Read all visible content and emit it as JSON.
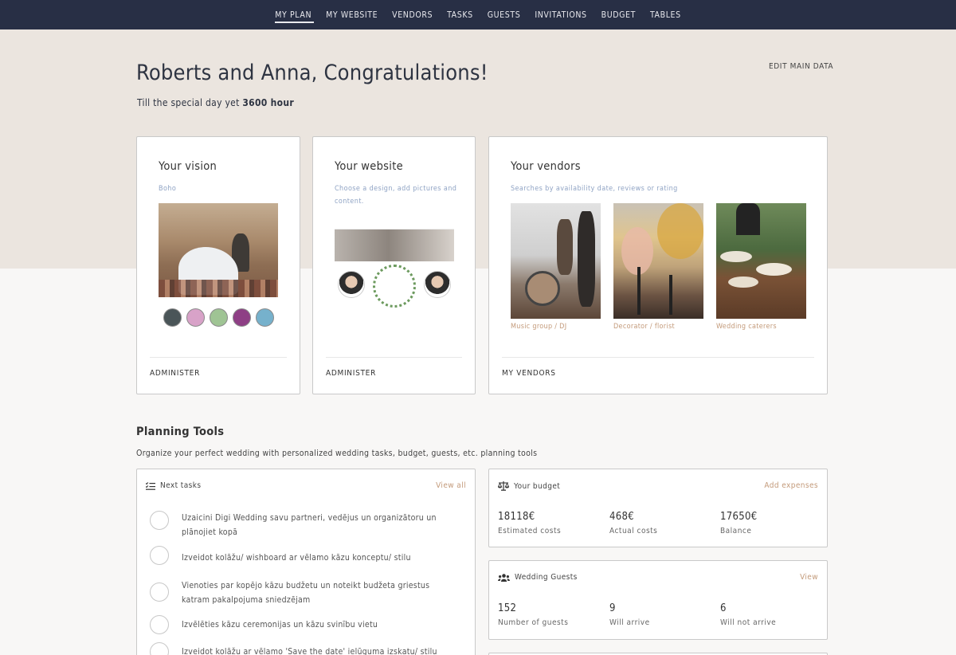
{
  "nav": {
    "items": [
      {
        "label": "MY PLAN",
        "active": true
      },
      {
        "label": "MY WEBSITE"
      },
      {
        "label": "VENDORS"
      },
      {
        "label": "TASKS"
      },
      {
        "label": "GUESTS"
      },
      {
        "label": "INVITATIONS"
      },
      {
        "label": "BUDGET"
      },
      {
        "label": "TABLES"
      }
    ]
  },
  "hero": {
    "title": "Roberts and Anna, Congratulations!",
    "countdown_prefix": "Till the special day yet ",
    "countdown_value": "3600 hour",
    "edit_label": "EDIT MAIN DATA"
  },
  "vision": {
    "title": "Your vision",
    "style": "Boho",
    "swatches": [
      "#4a5558",
      "#d8a2c8",
      "#9fc494",
      "#8e3f85",
      "#76b1cc"
    ],
    "footer": "ADMINISTER"
  },
  "website": {
    "title": "Your website",
    "desc": "Choose a design, add pictures and content.",
    "footer": "ADMINISTER"
  },
  "vendors": {
    "title": "Your vendors",
    "desc": "Searches by availability date, reviews or rating",
    "items": [
      {
        "caption": "Music group / DJ"
      },
      {
        "caption": "Decorator / florist"
      },
      {
        "caption": "Wedding caterers"
      }
    ],
    "footer": "MY VENDORS"
  },
  "planning": {
    "title": "Planning Tools",
    "subtitle": "Organize your perfect wedding with personalized wedding tasks, budget, guests, etc. planning tools"
  },
  "tasks": {
    "title": "Next tasks",
    "view_all": "View all",
    "items": [
      "Uzaicini Digi Wedding savu partneri, vedējus un organizātoru un plānojiet kopā",
      "Izveidot kolāžu/ wishboard ar vēlamo kāzu konceptu/ stilu",
      "Vienoties par kopējo kāzu budžetu un noteikt budžeta griestus katram pakalpojuma sniedzējam",
      "Izvēlēties kāzu ceremonijas un kāzu svinību vietu",
      "Izveidot kolāžu ar vēlamo 'Save the date' ielūguma izskatu/ stilu"
    ]
  },
  "budget": {
    "title": "Your budget",
    "action": "Add expenses",
    "stats": [
      {
        "value": "18118€",
        "label": "Estimated costs"
      },
      {
        "value": "468€",
        "label": "Actual costs"
      },
      {
        "value": "17650€",
        "label": "Balance"
      }
    ]
  },
  "guests": {
    "title": "Wedding Guests",
    "action": "View",
    "stats": [
      {
        "value": "152",
        "label": "Number of guests"
      },
      {
        "value": "9",
        "label": "Will arrive"
      },
      {
        "value": "6",
        "label": "Will not arrive"
      }
    ]
  }
}
